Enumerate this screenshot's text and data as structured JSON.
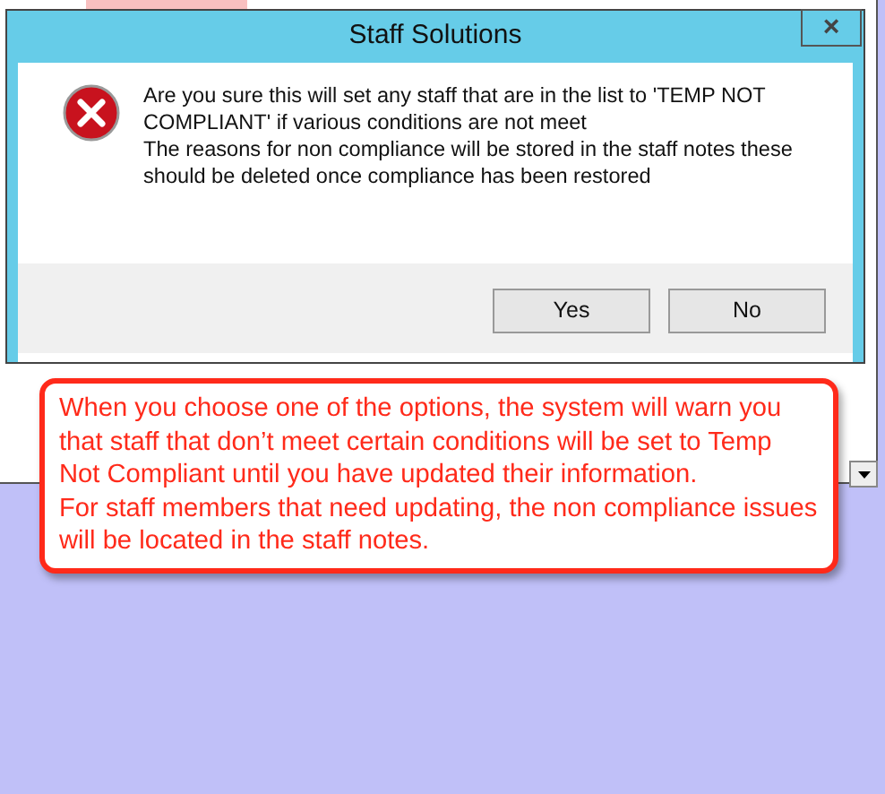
{
  "dialog": {
    "title": "Staff Solutions",
    "close": "×",
    "message": [
      "Are you sure this will set any staff that are in the list to 'TEMP NOT COMPLIANT' if various conditions are not meet",
      "The reasons for non compliance will be stored in the staff notes these should be deleted once compliance has been restored"
    ],
    "buttons": [
      "Yes",
      "No"
    ]
  },
  "callout": {
    "text": "When you choose one of the options, the system will warn you that staff that don’t meet certain conditions will be set to Temp Not Compliant until you have updated their information.\nFor staff members that need updating, the non compliance issues will be located in the staff notes."
  }
}
